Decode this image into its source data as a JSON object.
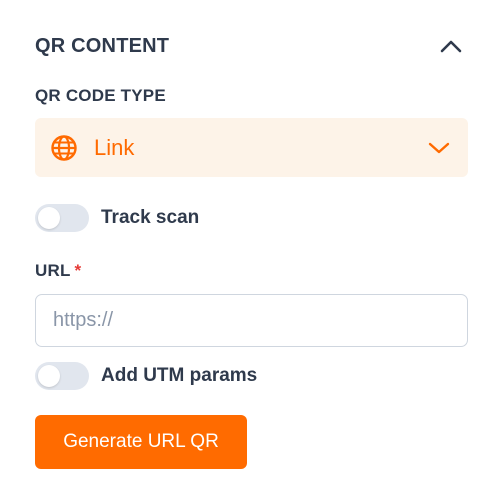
{
  "section": {
    "title": "QR CONTENT",
    "collapse_icon": "chevron-up-icon"
  },
  "qr_type": {
    "label": "QR CODE TYPE",
    "selected": "Link",
    "icon": "globe-icon",
    "dropdown_icon": "chevron-down-icon"
  },
  "track_scan": {
    "label": "Track scan",
    "enabled": false
  },
  "url_field": {
    "label": "URL",
    "required_marker": "*",
    "placeholder": "https://",
    "value": ""
  },
  "utm": {
    "label": "Add UTM params",
    "enabled": false
  },
  "actions": {
    "generate_label": "Generate URL QR"
  },
  "colors": {
    "accent": "#ff6b00",
    "accent_bg": "#fdf3e8",
    "text": "#2f3a4c",
    "required": "#e53935",
    "toggle_off": "#e1e6ee"
  }
}
